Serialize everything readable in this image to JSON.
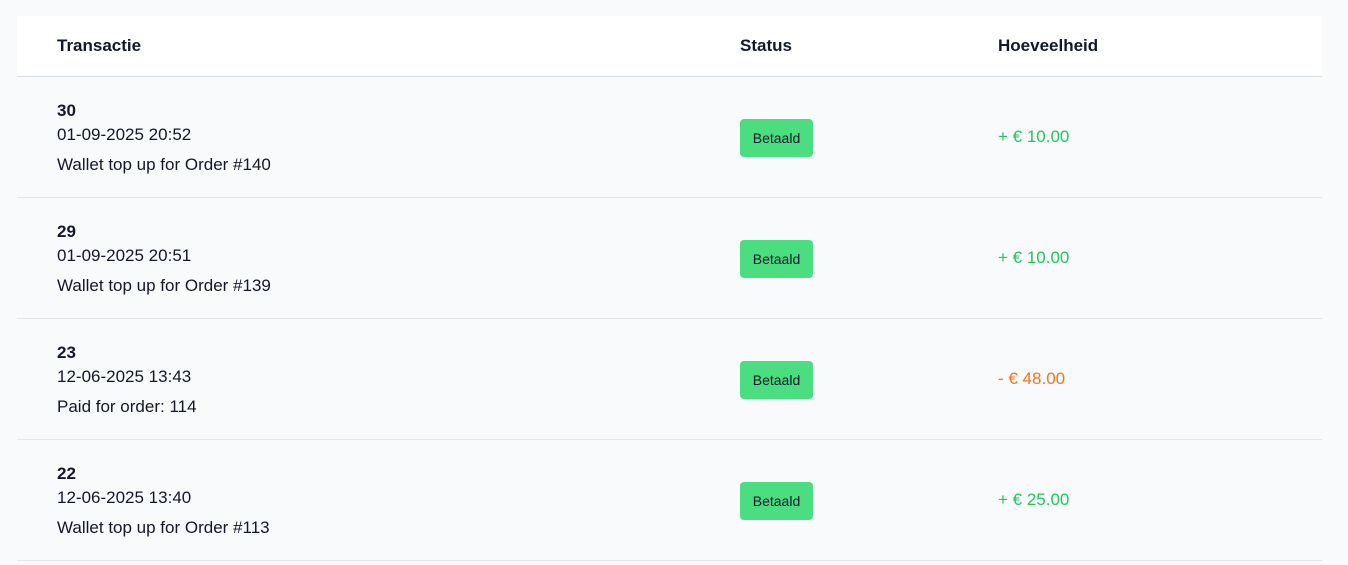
{
  "table": {
    "headers": {
      "transaction": "Transactie",
      "status": "Status",
      "amount": "Hoeveelheid"
    },
    "rows": [
      {
        "id": "30",
        "date": "01-09-2025 20:52",
        "description": "Wallet top up for Order #140",
        "status": "Betaald",
        "amount": "+ € 10.00",
        "amount_type": "positive"
      },
      {
        "id": "29",
        "date": "01-09-2025 20:51",
        "description": "Wallet top up for Order #139",
        "status": "Betaald",
        "amount": "+ € 10.00",
        "amount_type": "positive"
      },
      {
        "id": "23",
        "date": "12-06-2025 13:43",
        "description": "Paid for order: 114",
        "status": "Betaald",
        "amount": "- € 48.00",
        "amount_type": "negative"
      },
      {
        "id": "22",
        "date": "12-06-2025 13:40",
        "description": "Wallet top up for Order #113",
        "status": "Betaald",
        "amount": "+ € 25.00",
        "amount_type": "positive"
      }
    ]
  },
  "colors": {
    "positive": "#22c55e",
    "negative": "#f97316",
    "badge": "#4ade80"
  }
}
